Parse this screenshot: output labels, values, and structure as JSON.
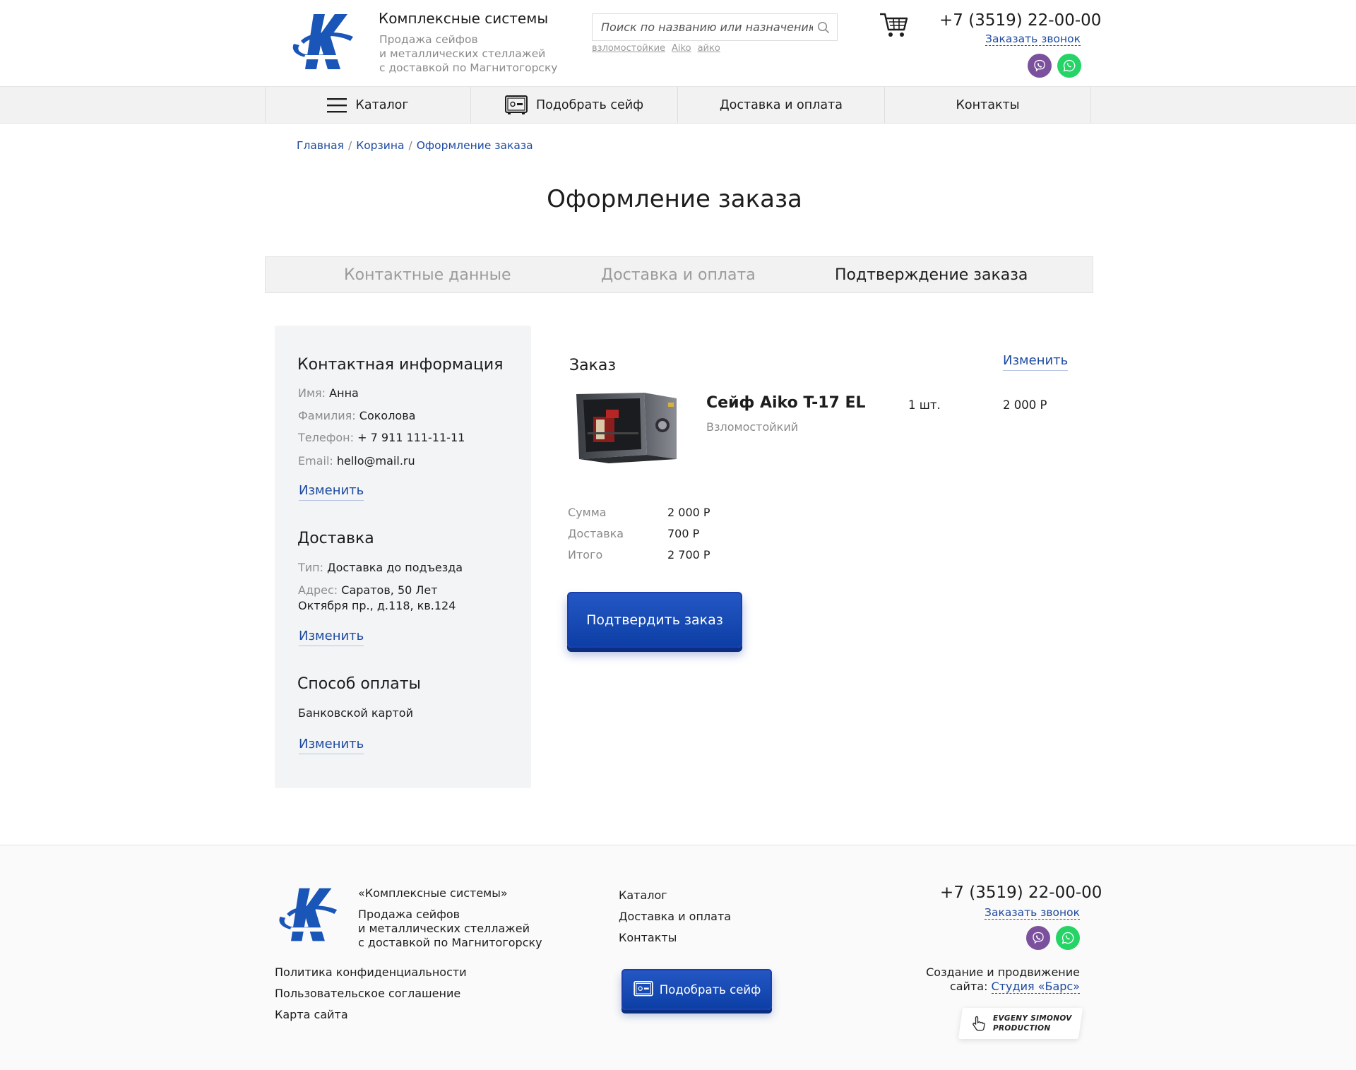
{
  "header": {
    "brand_title": "Комплексные системы",
    "brand_sub": "Продажа сейфов\nи металлических стеллажей\nс доставкой по Магнитогорску",
    "search_placeholder": "Поиск по названию или назначению",
    "search_hints": [
      "взломостойкие",
      "Aiko",
      "айко"
    ],
    "phone": "+7 (3519) 22-00-00",
    "call_link": "Заказать звонок"
  },
  "nav": {
    "items": [
      {
        "label": "Каталог",
        "icon": "menu-icon"
      },
      {
        "label": "Подобрать сейф",
        "icon": "safe-icon"
      },
      {
        "label": "Доставка и оплата"
      },
      {
        "label": "Контакты"
      }
    ]
  },
  "breadcrumb": [
    "Главная",
    "Корзина",
    "Оформление заказа"
  ],
  "page_title": "Оформление заказа",
  "steps": [
    {
      "label": "Контактные данные",
      "state": "inactive"
    },
    {
      "label": "Доставка и оплата",
      "state": "inactive"
    },
    {
      "label": "Подтверждение заказа",
      "state": "active"
    }
  ],
  "summary": {
    "contact": {
      "heading": "Контактная информация",
      "name_label": "Имя:",
      "name": "Анна",
      "surname_label": "Фамилия:",
      "surname": "Соколова",
      "phone_label": "Телефон:",
      "phone": "+ 7 911 111-11-11",
      "email_label": "Email:",
      "email": "hello@mail.ru",
      "edit": "Изменить"
    },
    "delivery": {
      "heading": "Доставка",
      "type_label": "Тип:",
      "type": "Доставка до подъезда",
      "address_label": "Адрес:",
      "address": "Саратов, 50 Лет Октября пр., д.118, кв.124",
      "edit": "Изменить"
    },
    "payment": {
      "heading": "Способ оплаты",
      "method": "Банковской картой",
      "edit": "Изменить"
    }
  },
  "order": {
    "heading": "Заказ",
    "edit": "Изменить",
    "product": {
      "name": "Сейф Aiko T-17 EL",
      "type": "Взломостойкий",
      "qty": "1 шт.",
      "price": "2 000 Р"
    },
    "totals": [
      {
        "label": "Сумма",
        "value": "2 000 Р"
      },
      {
        "label": "Доставка",
        "value": "700 Р"
      },
      {
        "label": "Итого",
        "value": "2 700 Р"
      }
    ],
    "confirm_button": "Подтвердить заказ"
  },
  "footer": {
    "brand": "«Комплексные системы»",
    "brand_sub": "Продажа сейфов\nи металлических стеллажей\nс доставкой по Магнитогорску",
    "links": [
      "Политика конфиденциальности",
      "Пользовательское соглашение",
      "Карта сайта"
    ],
    "nav": [
      "Каталог",
      "Доставка и оплата",
      "Контакты"
    ],
    "pick_button": "Подобрать сейф",
    "phone": "+7 (3519) 22-00-00",
    "call_link": "Заказать звонок",
    "credit_text": "Создание и продвижение",
    "credit_prefix": "сайта:",
    "credit_link": "Студия «Барс»",
    "badge_line1": "EVGENY SIMONOV",
    "badge_line2": "PRODUCTION"
  },
  "colors": {
    "accent": "#1d4aa0",
    "button": "#0c3fa5",
    "viber": "#7b519d",
    "whatsapp": "#25d366"
  }
}
